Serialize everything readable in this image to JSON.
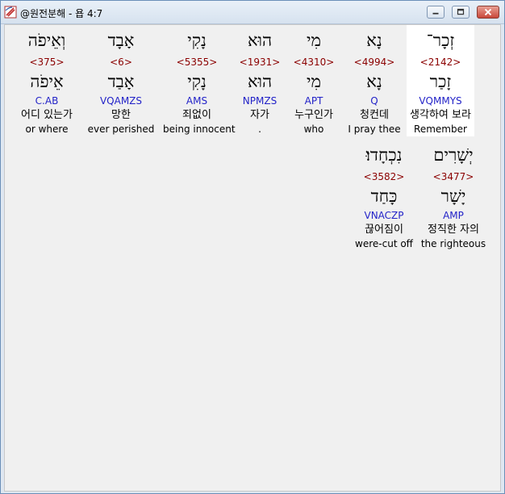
{
  "window": {
    "title": "@원전분해 - 욥 4:7"
  },
  "rows": [
    [
      {
        "hebrew": "זְכָר־",
        "strong": "<2142>",
        "hebrew_base": "זָכַר",
        "code": "VQMMYS",
        "korean": "생각하여 보라",
        "english": "Remember",
        "selected": true
      },
      {
        "hebrew": "נָא",
        "strong": "<4994>",
        "hebrew_base": "נָא",
        "code": "Q",
        "korean": "청컨데",
        "english": "I pray thee"
      },
      {
        "hebrew": "מִי",
        "strong": "<4310>",
        "hebrew_base": "מִי",
        "code": "APT",
        "korean": "누구인가",
        "english": "who"
      },
      {
        "hebrew": "הוּא",
        "strong": "<1931>",
        "hebrew_base": "הוּא",
        "code": "NPMZS",
        "korean": "자가",
        "english": "."
      },
      {
        "hebrew": "נָקִי",
        "strong": "<5355>",
        "hebrew_base": "נָקִי",
        "code": "AMS",
        "korean": "죄없이",
        "english": "being innocent"
      },
      {
        "hebrew": "אָבָד",
        "strong": "<6>",
        "hebrew_base": "אָבַד",
        "code": "VQAMZS",
        "korean": "망한",
        "english": "ever perished"
      },
      {
        "hebrew": "וְאֵיפֹה",
        "strong": "<375>",
        "hebrew_base": "אֵיפֹה",
        "code": "C.AB",
        "korean": "어디 있는가",
        "english": "or where"
      }
    ],
    [
      {
        "hebrew": "יְשָׁרִים",
        "strong": "<3477>",
        "hebrew_base": "יָשָׁר",
        "code": "AMP",
        "korean": "정직한 자의",
        "english": "the righteous"
      },
      {
        "hebrew": "נִכְחָדוּ׃",
        "strong": "<3582>",
        "hebrew_base": "כָּחַד",
        "code": "VNACZP",
        "korean": "끊어짐이",
        "english": "were-cut off"
      }
    ]
  ]
}
